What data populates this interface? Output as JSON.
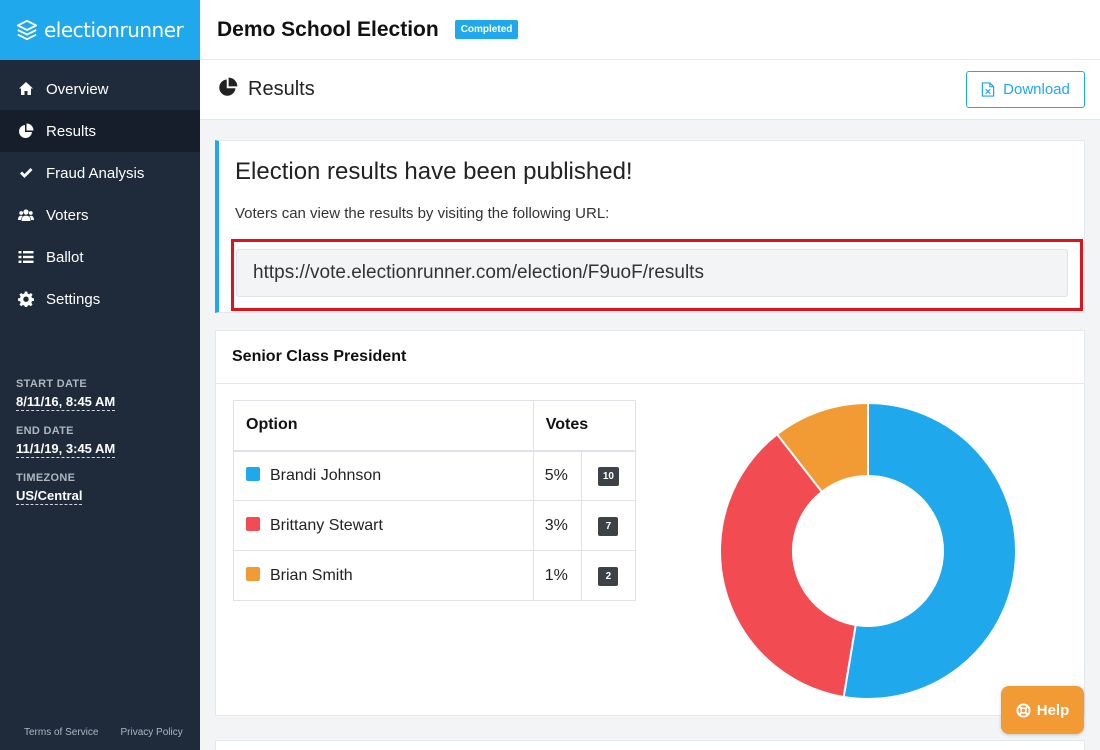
{
  "brand": {
    "name": "electionrunner",
    "icon": "layers-logo-icon"
  },
  "topbar": {
    "title": "Demo School Election",
    "status": "Completed"
  },
  "sidebar": {
    "items": [
      {
        "label": "Overview",
        "icon": "home-icon",
        "active": false
      },
      {
        "label": "Results",
        "icon": "pie-chart-icon",
        "active": true
      },
      {
        "label": "Fraud Analysis",
        "icon": "check-icon",
        "active": false
      },
      {
        "label": "Voters",
        "icon": "users-icon",
        "active": false
      },
      {
        "label": "Ballot",
        "icon": "list-icon",
        "active": false
      },
      {
        "label": "Settings",
        "icon": "gear-icon",
        "active": false
      }
    ],
    "meta": {
      "start_label": "START DATE",
      "start_value": "8/11/16, 8:45 AM",
      "end_label": "END DATE",
      "end_value": "11/1/19, 3:45 AM",
      "tz_label": "TIMEZONE",
      "tz_value": "US/Central"
    },
    "footer": {
      "terms": "Terms of Service",
      "privacy": "Privacy Policy"
    }
  },
  "page": {
    "title": "Results",
    "download_label": "Download"
  },
  "publish": {
    "title": "Election results have been published!",
    "description": "Voters can view the results by visiting the following URL:",
    "url": "https://vote.electionrunner.com/election/F9uoF/results"
  },
  "race": {
    "title": "Senior Class President",
    "columns": {
      "option": "Option",
      "votes": "Votes"
    },
    "rows": [
      {
        "name": "Brandi Johnson",
        "pct": "5%",
        "count": "10",
        "color": "#1fa9ec"
      },
      {
        "name": "Brittany Stewart",
        "pct": "3%",
        "count": "7",
        "color": "#f24b52"
      },
      {
        "name": "Brian Smith",
        "pct": "1%",
        "count": "2",
        "color": "#f29a33"
      }
    ]
  },
  "chart_data": {
    "type": "pie",
    "categories": [
      "Brandi Johnson",
      "Brittany Stewart",
      "Brian Smith"
    ],
    "values": [
      10,
      7,
      2
    ],
    "colors": [
      "#1fa9ec",
      "#f24b52",
      "#f29a33"
    ]
  },
  "help": {
    "label": "Help"
  }
}
